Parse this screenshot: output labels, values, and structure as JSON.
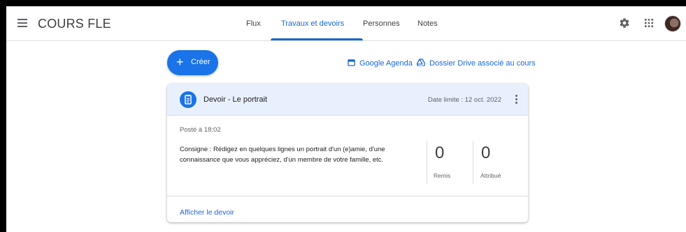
{
  "header": {
    "title": "COURS FLE",
    "tabs": [
      {
        "label": "Flux"
      },
      {
        "label": "Travaux et devoirs"
      },
      {
        "label": "Personnes"
      },
      {
        "label": "Notes"
      }
    ],
    "active_tab": "Travaux et devoirs"
  },
  "actions": {
    "create_label": "Créer",
    "calendar_label": "Google Agenda",
    "drive_label": "Dossier Drive associé au cours"
  },
  "assignment": {
    "title": "Devoir - Le portrait",
    "due": "Date limite : 12 oct. 2022",
    "posted": "Posté à 18:02",
    "instructions": "Consigne : Rédigez en quelques lignes un portrait d'un (e)amie, d'une connaissance que vous appréciez, d'un membre de votre famille, etc.",
    "stats": [
      {
        "value": "0",
        "label": "Remis"
      },
      {
        "value": "0",
        "label": "Attribué"
      }
    ],
    "view_label": "Afficher le devoir"
  },
  "colors": {
    "accent": "#1a73e8",
    "link": "#1967d2",
    "card_header": "#e8f0fe"
  },
  "icons": [
    "menu-icon",
    "gear-icon",
    "apps-icon",
    "avatar",
    "plus-icon",
    "calendar-icon",
    "drive-icon",
    "assignment-icon",
    "more-vert-icon"
  ]
}
